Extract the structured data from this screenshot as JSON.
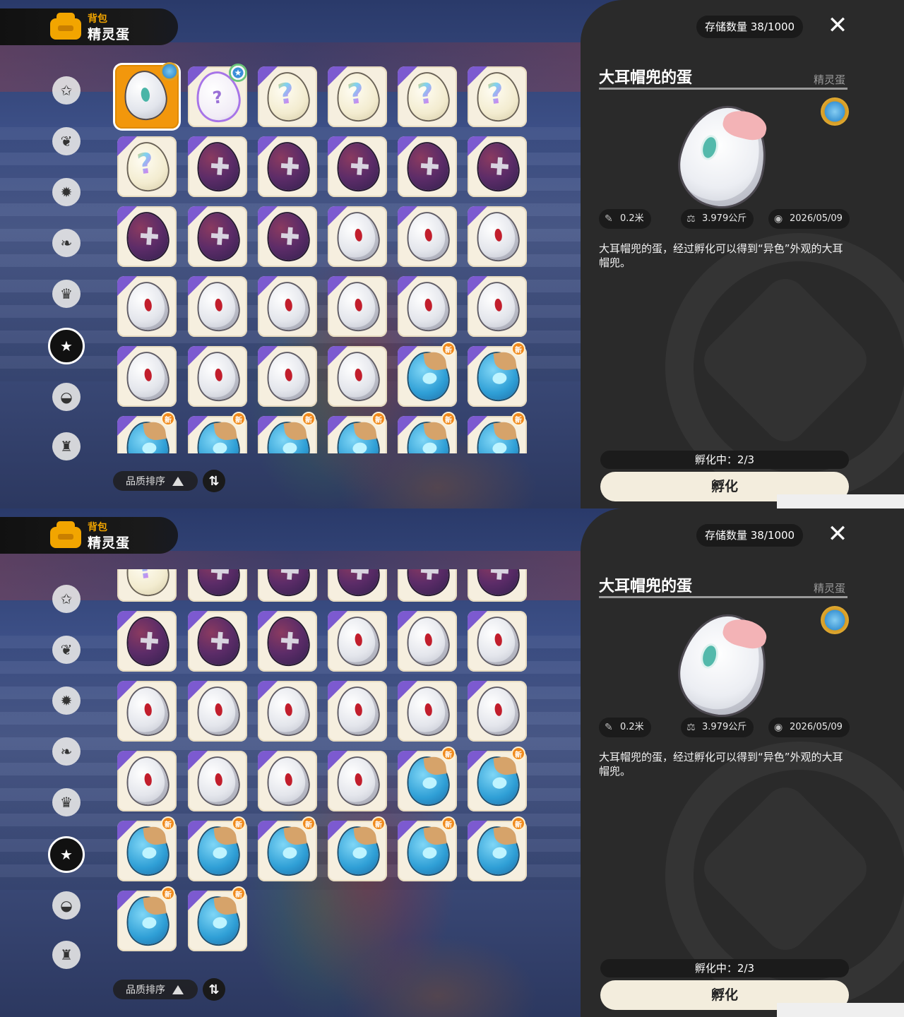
{
  "header": {
    "small_title": "背包",
    "big_title": "精灵蛋"
  },
  "side_nav": [
    "star-category",
    "leaf-category",
    "sparkle-category",
    "plant-category",
    "crown-category",
    "egg-category",
    "acorn-category",
    "chair-category"
  ],
  "sort": {
    "label": "品质排序",
    "toggle_icon": "⇅"
  },
  "panel": {
    "storage": "存储数量 38/1000",
    "item_name": "大耳帽兜的蛋",
    "item_category": "精灵蛋",
    "stats": {
      "size": "0.2米",
      "weight": "3.979公斤",
      "date": "2026/05/09"
    },
    "description": "大耳帽兜的蛋，经过孵化可以得到“异色”外观的大耳帽兜。",
    "hatching_status": "孵化中：2/3",
    "hatch_button": "孵化"
  },
  "new_badge": "新",
  "grid_top": [
    [
      "sel",
      "outline",
      "rainbow",
      "rainbow",
      "rainbow",
      "rainbow"
    ],
    [
      "rainbow",
      "purple",
      "purple",
      "purple",
      "purple",
      "purple"
    ],
    [
      "purple",
      "purple",
      "purple",
      "white",
      "white",
      "white"
    ],
    [
      "white",
      "white",
      "white",
      "white",
      "white",
      "white"
    ],
    [
      "white",
      "white",
      "white",
      "white",
      "blue",
      "blue"
    ],
    [
      "blue",
      "blue",
      "blue",
      "blue",
      "blue",
      "blue"
    ]
  ],
  "grid_bottom": [
    [
      "rainbow",
      "purple",
      "purple",
      "purple",
      "purple",
      "purple"
    ],
    [
      "purple",
      "purple",
      "purple",
      "white",
      "white",
      "white"
    ],
    [
      "white",
      "white",
      "white",
      "white",
      "white",
      "white"
    ],
    [
      "white",
      "white",
      "white",
      "white",
      "blue",
      "blue"
    ],
    [
      "blue",
      "blue",
      "blue",
      "blue",
      "blue",
      "blue"
    ],
    [
      "blue",
      "blue"
    ]
  ]
}
